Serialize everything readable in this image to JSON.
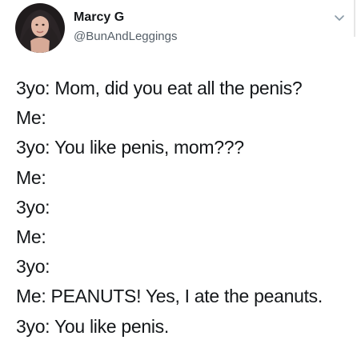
{
  "tweet": {
    "author": {
      "display_name": "Marcy G",
      "handle": "@BunAndLeggings"
    },
    "menu_icon": "chevron-down-icon",
    "lines": [
      "3yo: Mom, did you eat all the penis?",
      "Me:",
      "3yo: You like penis, mom???",
      "Me:",
      "3yo:",
      "Me:",
      "3yo:",
      "Me: PEANUTS! Yes, I ate the peanuts.",
      "3yo: You like penis."
    ]
  }
}
